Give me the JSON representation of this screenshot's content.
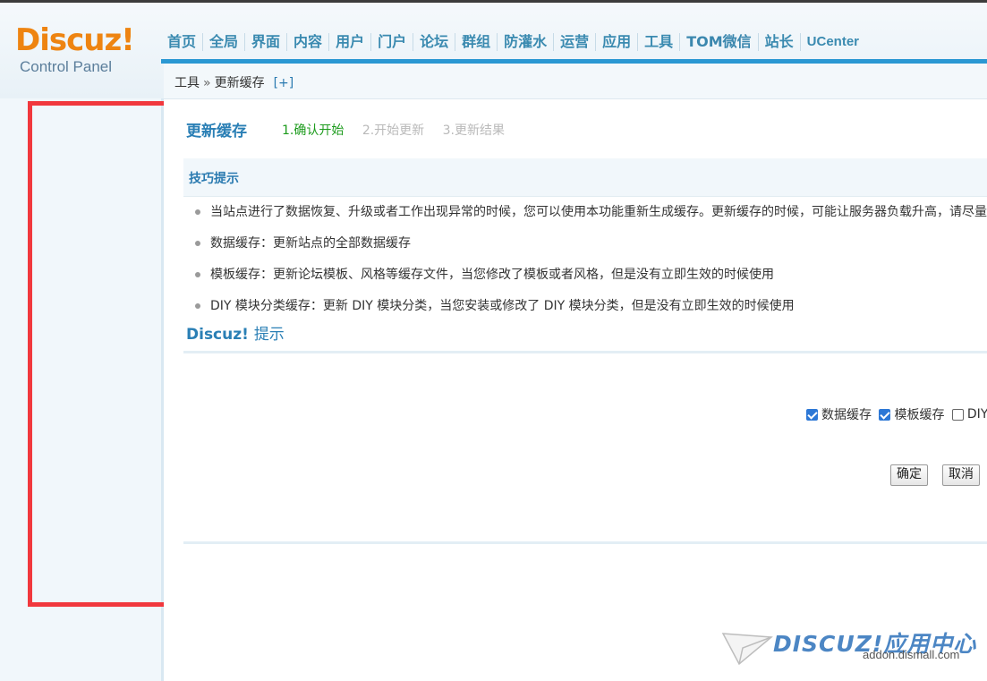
{
  "header": {
    "logo_brand": "Discuz!",
    "logo_sub": "Control Panel",
    "nav": [
      "首页",
      "全局",
      "界面",
      "内容",
      "用户",
      "门户",
      "论坛",
      "群组",
      "防灌水",
      "运营",
      "应用",
      "工具",
      "TOM微信",
      "站长",
      "UCenter"
    ]
  },
  "breadcrumb": {
    "root": "工具",
    "separator": "»",
    "current": "更新缓存",
    "add_label": "[+]"
  },
  "page": {
    "title": "更新缓存",
    "steps": [
      {
        "label": "1.确认开始",
        "state": "current"
      },
      {
        "label": "2.开始更新",
        "state": "pending"
      },
      {
        "label": "3.更新结果",
        "state": "pending"
      }
    ]
  },
  "tips": {
    "heading": "技巧提示",
    "items": [
      "当站点进行了数据恢复、升级或者工作出现异常的时候，您可以使用本功能重新生成缓存。更新缓存的时候，可能让服务器负载升高，请尽量",
      "数据缓存：更新站点的全部数据缓存",
      "模板缓存：更新论坛模板、风格等缓存文件，当您修改了模板或者风格，但是没有立即生效的时候使用",
      "DIY 模块分类缓存：更新 DIY 模块分类，当您安装或修改了 DIY 模块分类，但是没有立即生效的时候使用"
    ]
  },
  "discuz_tip": {
    "brand": "Discuz!",
    "text": "提示"
  },
  "form": {
    "options": [
      {
        "label": "数据缓存",
        "checked": true
      },
      {
        "label": "模板缓存",
        "checked": true
      },
      {
        "label": "DIY",
        "checked": false
      }
    ],
    "confirm_label": "确定",
    "cancel_label": "取消"
  },
  "watermark": {
    "brand": "DISCUZ!应用中心",
    "url": "addon.dismall.com"
  },
  "colors": {
    "accent": "#2a98d3",
    "logo": "#ee8411",
    "highlight_box": "#f1383d",
    "step_current": "#1c9b1c"
  }
}
